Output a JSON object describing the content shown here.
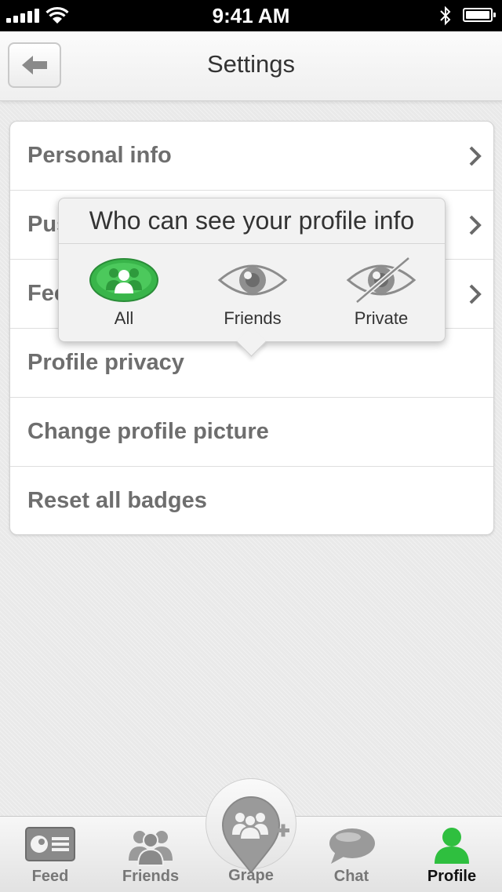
{
  "status_bar": {
    "time": "9:41 AM"
  },
  "nav": {
    "title": "Settings"
  },
  "settings": {
    "rows": [
      {
        "label": "Personal info"
      },
      {
        "label": "Push notifications"
      },
      {
        "label": "Feedback"
      },
      {
        "label": "Profile privacy"
      },
      {
        "label": "Change profile picture"
      },
      {
        "label": "Reset all badges"
      }
    ]
  },
  "popover": {
    "title": "Who can see your profile info",
    "options": [
      {
        "label": "All",
        "selected": true
      },
      {
        "label": "Friends",
        "selected": false
      },
      {
        "label": "Private",
        "selected": false
      }
    ]
  },
  "tabs": [
    {
      "label": "Feed"
    },
    {
      "label": "Friends"
    },
    {
      "label": "Grape"
    },
    {
      "label": "Chat"
    },
    {
      "label": "Profile"
    }
  ],
  "colors": {
    "accent": "#39b54a",
    "text": "#6e6e6e",
    "muted": "#9a9a9a"
  }
}
